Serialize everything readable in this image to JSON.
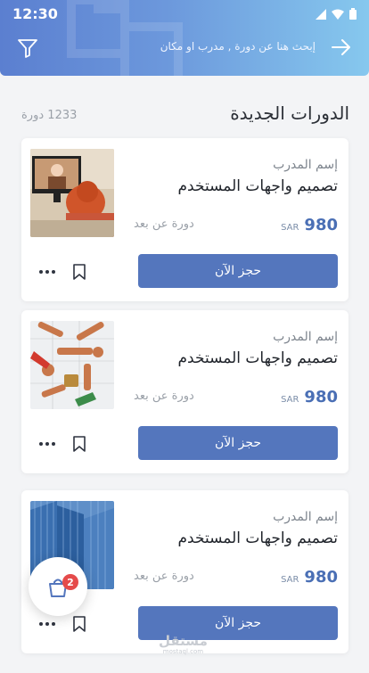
{
  "status": {
    "time": "12:30"
  },
  "header": {
    "search_placeholder": "إبحث هنا عن دورة , مدرب او مكان"
  },
  "section": {
    "title": "الدورات الجديدة",
    "count": "1233 دورة"
  },
  "courses": [
    {
      "trainer": "إسم المدرب",
      "title": "تصميم واجهات المستخدم",
      "price": "980",
      "currency": "SAR",
      "mode": "دورة عن بعد",
      "book_label": "حجز الآن"
    },
    {
      "trainer": "إسم المدرب",
      "title": "تصميم واجهات المستخدم",
      "price": "980",
      "currency": "SAR",
      "mode": "دورة عن بعد",
      "book_label": "حجز الآن"
    },
    {
      "trainer": "إسم المدرب",
      "title": "تصميم واجهات المستخدم",
      "price": "980",
      "currency": "SAR",
      "mode": "دورة عن بعد",
      "book_label": "حجز الآن"
    }
  ],
  "cart": {
    "badge": "2"
  },
  "watermark": {
    "text": "مستقل",
    "sub": "mostaql.com"
  },
  "colors": {
    "accent": "#5476bd",
    "price": "#4a6fb5",
    "badge": "#e54b4b"
  }
}
